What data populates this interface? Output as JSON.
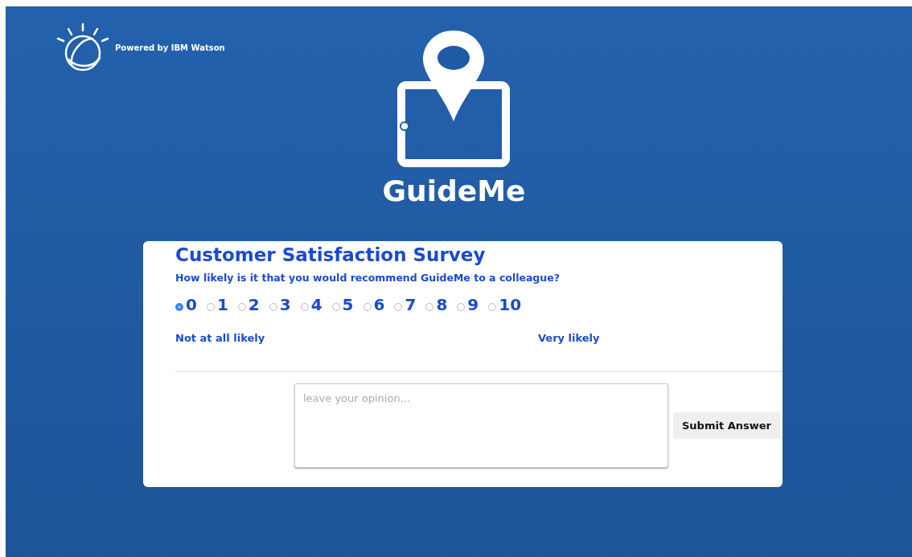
{
  "branding": {
    "powered_by": "Powered by IBM Watson",
    "app_name": "GuideMe"
  },
  "survey": {
    "title": "Customer Satisfaction Survey",
    "question": "How likely is it that you would recommend GuideMe to a colleague?",
    "options": [
      {
        "label": "0",
        "selected": true
      },
      {
        "label": "1",
        "selected": false
      },
      {
        "label": "2",
        "selected": false
      },
      {
        "label": "3",
        "selected": false
      },
      {
        "label": "4",
        "selected": false
      },
      {
        "label": "5",
        "selected": false
      },
      {
        "label": "6",
        "selected": false
      },
      {
        "label": "7",
        "selected": false
      },
      {
        "label": "8",
        "selected": false
      },
      {
        "label": "9",
        "selected": false
      },
      {
        "label": "10",
        "selected": false
      }
    ],
    "low_label": "Not at all likely",
    "high_label": "Very likely",
    "comment": {
      "placeholder": "leave your opinion..."
    },
    "submit_button": "Submit Answer"
  }
}
